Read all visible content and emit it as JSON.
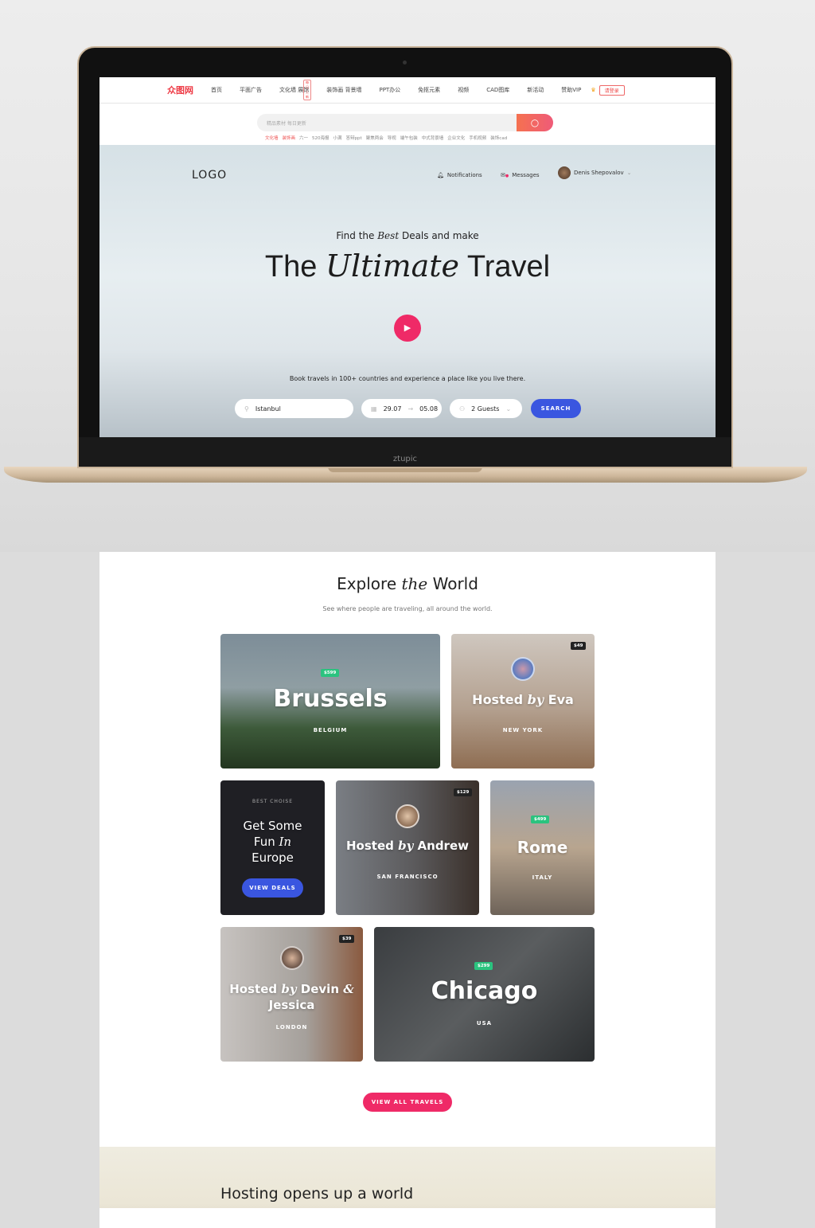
{
  "device": {
    "brand_label": "ztupic"
  },
  "cn_site": {
    "logo": "众图网",
    "nav": [
      "首页",
      "平面广告",
      "文化墙 展馆",
      "装饰画 背景墙",
      "PPT办公",
      "免抠元素",
      "视频",
      "CAD图库",
      "新活动",
      "赞助VIP"
    ],
    "nav_badge": "每日上新",
    "login": "请登录",
    "search_placeholder": "精品素材 每日更新",
    "hot_tags": [
      "文化墙",
      "装饰画",
      "六一",
      "520海报",
      "小满",
      "答辩ppt",
      "聚焦两会",
      "导视",
      "端午包装",
      "中式背景墙",
      "企业文化",
      "手机视频",
      "装饰cad"
    ]
  },
  "hero": {
    "logo": "LOGO",
    "notifications": "Notifications",
    "messages": "Messages",
    "user": "Denis Shepovalov",
    "subtitle_pre": "Find the ",
    "subtitle_em": "Best",
    "subtitle_post": " Deals and make",
    "title_pre": "The ",
    "title_em": "Ultimate",
    "title_post": " Travel",
    "book_text": "Book travels in 100+ countries and experience a place like you live there.",
    "location": "Istanbul",
    "date_from": "29.07",
    "date_arrow": "→",
    "date_to": "05.08",
    "guests": "2 Guests",
    "search": "SEARCH"
  },
  "explore": {
    "title_pre": "Explore ",
    "title_em": "the",
    "title_post": " World",
    "description": "See where people are traveling, all around the world.",
    "cards": {
      "brussels": {
        "title": "Brussels",
        "location": "BELGIUM",
        "price": "$599"
      },
      "eva": {
        "title_pre": "Hosted ",
        "title_em": "by",
        "title_post": " Eva",
        "location": "NEW YORK",
        "price": "$49"
      },
      "promo": {
        "kicker": "BEST CHOISE",
        "line1": "Get Some",
        "line2_pre": "Fun ",
        "line2_em": "In",
        "line3": "Europe",
        "button": "VIEW DEALS"
      },
      "andrew": {
        "title_pre": "Hosted ",
        "title_em": "by",
        "title_post": " Andrew",
        "location": "SAN FRANCISCO",
        "price": "$129"
      },
      "rome": {
        "title": "Rome",
        "location": "ITALY",
        "price": "$499"
      },
      "devin": {
        "title_pre": "Hosted ",
        "title_em": "by",
        "title_post": " Devin ",
        "title_amp": "&",
        "title_line2": "Jessica",
        "location": "LONDON",
        "price": "$39"
      },
      "chicago": {
        "title": "Chicago",
        "location": "USA",
        "price": "$299"
      }
    },
    "view_all": "VIEW ALL TRAVELS"
  },
  "hosting": {
    "title": "Hosting opens up a world"
  },
  "colors": {
    "accent_pink": "#ef2a67",
    "accent_blue": "#3a56e0",
    "price_green": "#2bc37f"
  }
}
